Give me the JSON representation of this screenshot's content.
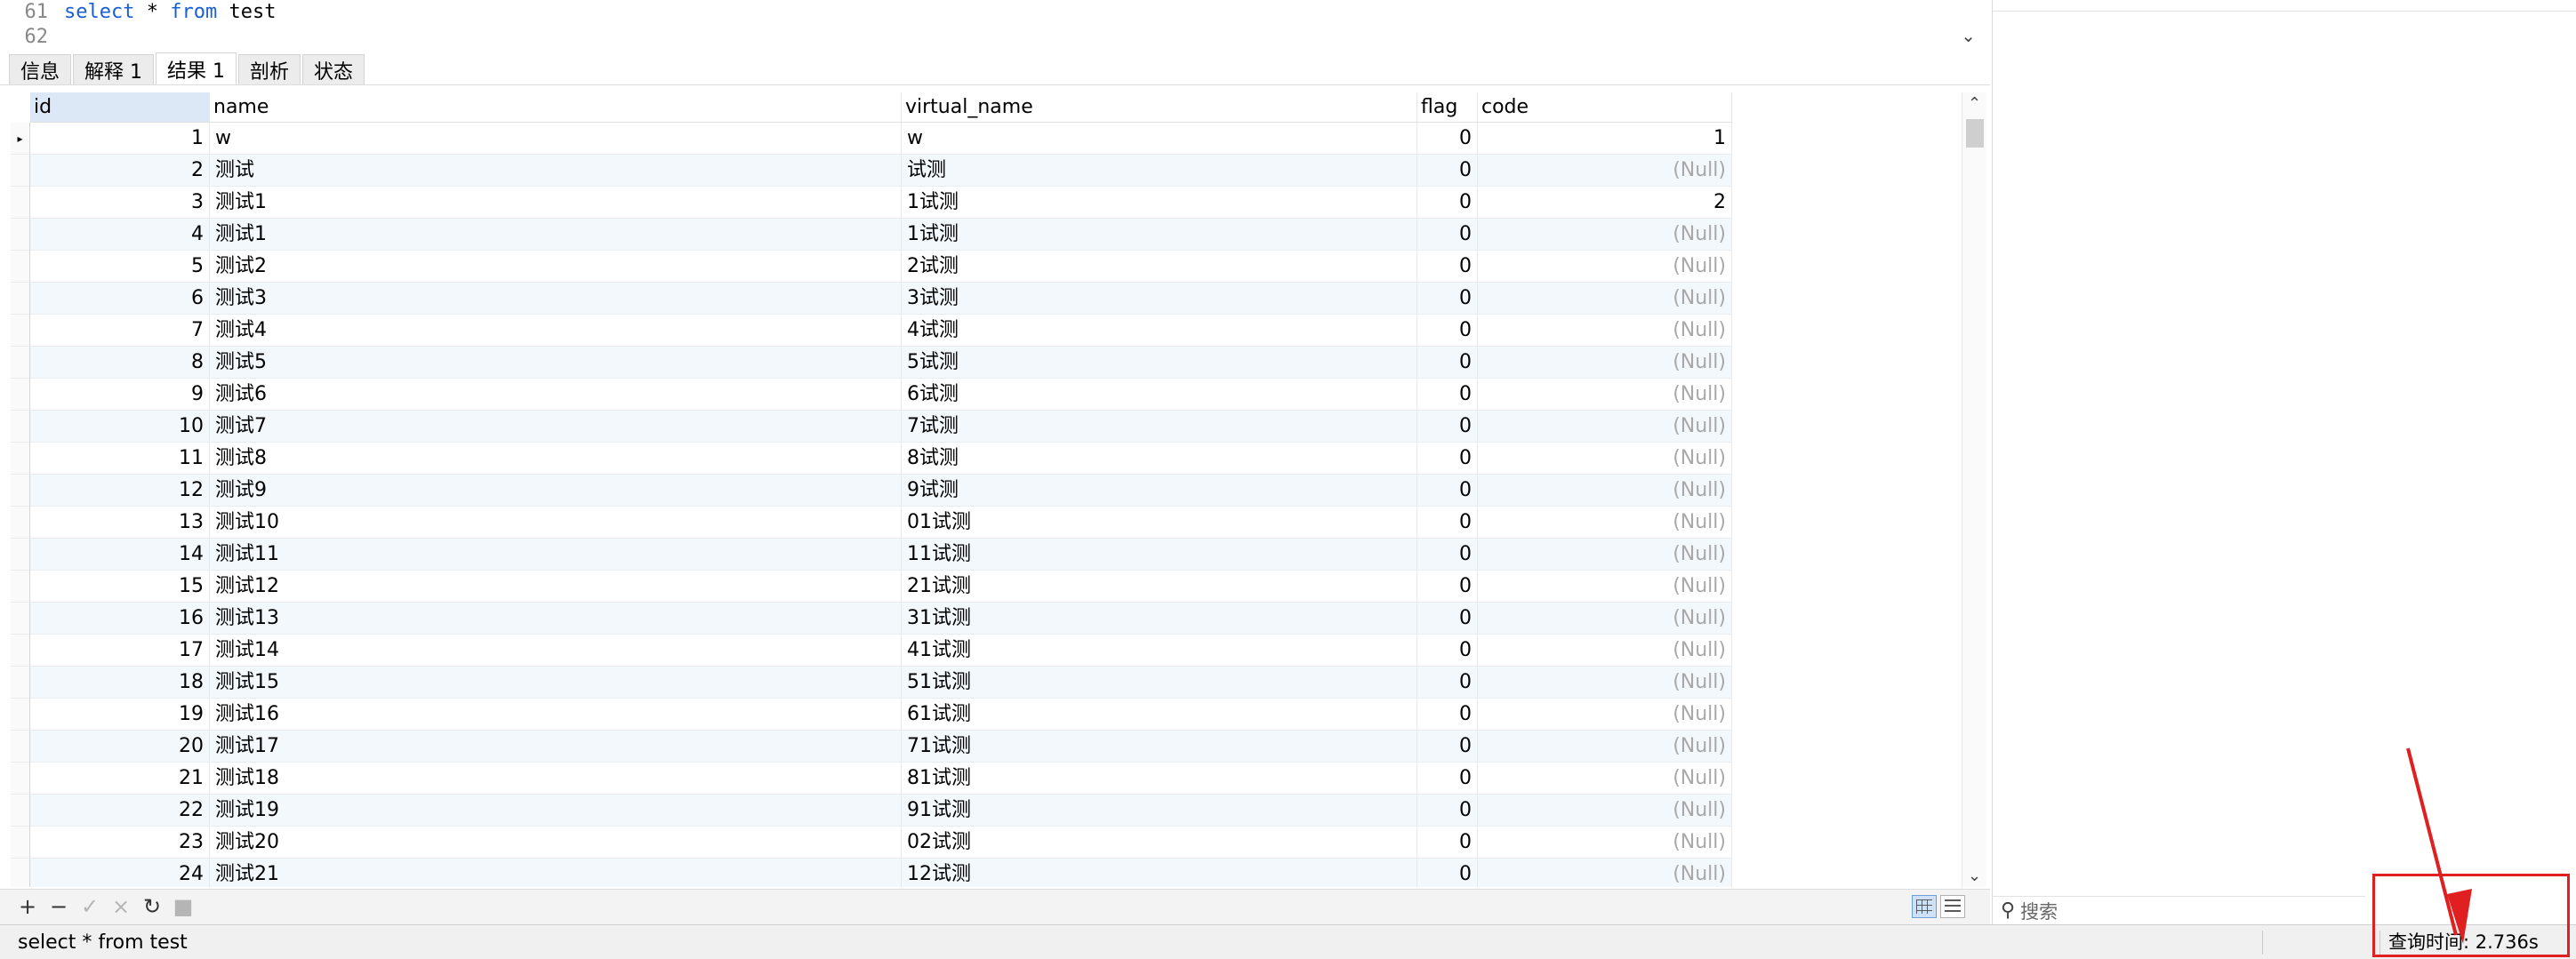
{
  "editor": {
    "lines": [
      {
        "num": "61",
        "kw1": "select",
        "mid": " * ",
        "kw2": "from",
        "rest": " test"
      },
      {
        "num": "62",
        "kw1": "",
        "mid": "",
        "kw2": "",
        "rest": ""
      }
    ]
  },
  "tabs": [
    {
      "label": "信息",
      "active": false
    },
    {
      "label": "解释 1",
      "active": false
    },
    {
      "label": "结果 1",
      "active": true
    },
    {
      "label": "剖析",
      "active": false
    },
    {
      "label": "状态",
      "active": false
    }
  ],
  "grid": {
    "columns": [
      {
        "key": "id",
        "label": "id"
      },
      {
        "key": "name",
        "label": "name"
      },
      {
        "key": "virtual_name",
        "label": "virtual_name"
      },
      {
        "key": "flag",
        "label": "flag"
      },
      {
        "key": "code",
        "label": "code"
      }
    ],
    "null_text": "(Null)",
    "rows": [
      {
        "id": "1",
        "name": "w",
        "virtual_name": "w",
        "flag": "0",
        "code": "1"
      },
      {
        "id": "2",
        "name": "测试",
        "virtual_name": "试测",
        "flag": "0",
        "code": null
      },
      {
        "id": "3",
        "name": "测试1",
        "virtual_name": "1试测",
        "flag": "0",
        "code": "2"
      },
      {
        "id": "4",
        "name": "测试1",
        "virtual_name": "1试测",
        "flag": "0",
        "code": null
      },
      {
        "id": "5",
        "name": "测试2",
        "virtual_name": "2试测",
        "flag": "0",
        "code": null
      },
      {
        "id": "6",
        "name": "测试3",
        "virtual_name": "3试测",
        "flag": "0",
        "code": null
      },
      {
        "id": "7",
        "name": "测试4",
        "virtual_name": "4试测",
        "flag": "0",
        "code": null
      },
      {
        "id": "8",
        "name": "测试5",
        "virtual_name": "5试测",
        "flag": "0",
        "code": null
      },
      {
        "id": "9",
        "name": "测试6",
        "virtual_name": "6试测",
        "flag": "0",
        "code": null
      },
      {
        "id": "10",
        "name": "测试7",
        "virtual_name": "7试测",
        "flag": "0",
        "code": null
      },
      {
        "id": "11",
        "name": "测试8",
        "virtual_name": "8试测",
        "flag": "0",
        "code": null
      },
      {
        "id": "12",
        "name": "测试9",
        "virtual_name": "9试测",
        "flag": "0",
        "code": null
      },
      {
        "id": "13",
        "name": "测试10",
        "virtual_name": "01试测",
        "flag": "0",
        "code": null
      },
      {
        "id": "14",
        "name": "测试11",
        "virtual_name": "11试测",
        "flag": "0",
        "code": null
      },
      {
        "id": "15",
        "name": "测试12",
        "virtual_name": "21试测",
        "flag": "0",
        "code": null
      },
      {
        "id": "16",
        "name": "测试13",
        "virtual_name": "31试测",
        "flag": "0",
        "code": null
      },
      {
        "id": "17",
        "name": "测试14",
        "virtual_name": "41试测",
        "flag": "0",
        "code": null
      },
      {
        "id": "18",
        "name": "测试15",
        "virtual_name": "51试测",
        "flag": "0",
        "code": null
      },
      {
        "id": "19",
        "name": "测试16",
        "virtual_name": "61试测",
        "flag": "0",
        "code": null
      },
      {
        "id": "20",
        "name": "测试17",
        "virtual_name": "71试测",
        "flag": "0",
        "code": null
      },
      {
        "id": "21",
        "name": "测试18",
        "virtual_name": "81试测",
        "flag": "0",
        "code": null
      },
      {
        "id": "22",
        "name": "测试19",
        "virtual_name": "91试测",
        "flag": "0",
        "code": null
      },
      {
        "id": "23",
        "name": "测试20",
        "virtual_name": "02试测",
        "flag": "0",
        "code": null
      },
      {
        "id": "24",
        "name": "测试21",
        "virtual_name": "12试测",
        "flag": "0",
        "code": null
      }
    ]
  },
  "toolbar": {
    "buttons": [
      {
        "name": "add-record-button",
        "glyph": "+",
        "enabled": true
      },
      {
        "name": "delete-record-button",
        "glyph": "−",
        "enabled": true
      },
      {
        "name": "apply-changes-button",
        "glyph": "✓",
        "enabled": false
      },
      {
        "name": "discard-changes-button",
        "glyph": "×",
        "enabled": false
      },
      {
        "name": "refresh-button",
        "glyph": "↻",
        "enabled": true
      },
      {
        "name": "stop-button",
        "glyph": "■",
        "enabled": false
      }
    ]
  },
  "right_panel": {
    "search_placeholder": "搜索"
  },
  "status": {
    "sql": "select * from test",
    "query_time": "查询时间: 2.736s"
  },
  "annotation": {
    "color": "#e02020"
  }
}
